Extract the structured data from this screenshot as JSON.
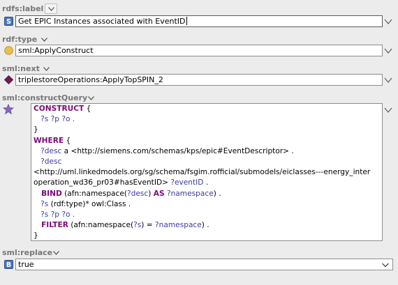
{
  "properties": [
    {
      "label": "rdfs:label",
      "value": "Get EPIC Instances associated with EventID",
      "icon": "string-type-icon"
    },
    {
      "label": "rdf:type",
      "value": "sml:ApplyConstruct",
      "icon": "class-type-icon"
    },
    {
      "label": "sml:next",
      "value": "triplestoreOperations:ApplyTopSPIN_2",
      "icon": "instance-type-icon"
    },
    {
      "label": "sml:constructQuery",
      "icon": "spin-query-icon"
    },
    {
      "label": "sml:replace",
      "value": "true",
      "icon": "boolean-type-icon"
    }
  ],
  "query_lines": [
    [
      {
        "t": "CONSTRUCT",
        "c": "kw"
      },
      {
        "t": " {",
        "c": ""
      }
    ],
    [
      {
        "t": "   ?s ?p ?o .",
        "c": "var"
      }
    ],
    [
      {
        "t": "}",
        "c": ""
      }
    ],
    [
      {
        "t": "WHERE",
        "c": "kw"
      },
      {
        "t": " {",
        "c": ""
      }
    ],
    [
      {
        "t": "   ?desc",
        "c": "var"
      },
      {
        "t": " a <http://siemens.com/schemas/kps/epic#EventDescriptor> .",
        "c": ""
      }
    ],
    [
      {
        "t": "   ?desc",
        "c": "var"
      }
    ],
    [
      {
        "t": "<http://uml.linkedmodels.org/sg/schema/fsgim.rofficial/submodels/eiclasses---energy_inter",
        "c": ""
      }
    ],
    [
      {
        "t": "operation_wd36_pr03#hasEventID> ",
        "c": ""
      },
      {
        "t": "?eventID",
        "c": "var"
      },
      {
        "t": " .",
        "c": ""
      }
    ],
    [
      {
        "t": "   BIND",
        "c": "kw"
      },
      {
        "t": " (afn:namespace(",
        "c": ""
      },
      {
        "t": "?desc",
        "c": "var"
      },
      {
        "t": ") ",
        "c": ""
      },
      {
        "t": "AS",
        "c": "kw"
      },
      {
        "t": " ",
        "c": ""
      },
      {
        "t": "?namespace",
        "c": "var"
      },
      {
        "t": ") .",
        "c": ""
      }
    ],
    [
      {
        "t": "   ?s",
        "c": "var"
      },
      {
        "t": " (rdf:type)* owl:Class .",
        "c": ""
      }
    ],
    [
      {
        "t": "   ?s ?p ?o .",
        "c": "var"
      }
    ],
    [
      {
        "t": "   FILTER",
        "c": "kw"
      },
      {
        "t": " (afn:namespace(",
        "c": ""
      },
      {
        "t": "?s",
        "c": "var"
      },
      {
        "t": ") = ",
        "c": ""
      },
      {
        "t": "?namespace",
        "c": "var"
      },
      {
        "t": ") .",
        "c": ""
      }
    ],
    [
      {
        "t": "}",
        "c": ""
      }
    ]
  ],
  "colors": {
    "keyword": "#7a0a7a",
    "variable": "#3b3b9e",
    "label_gray": "#777777",
    "background": "#ececec"
  }
}
